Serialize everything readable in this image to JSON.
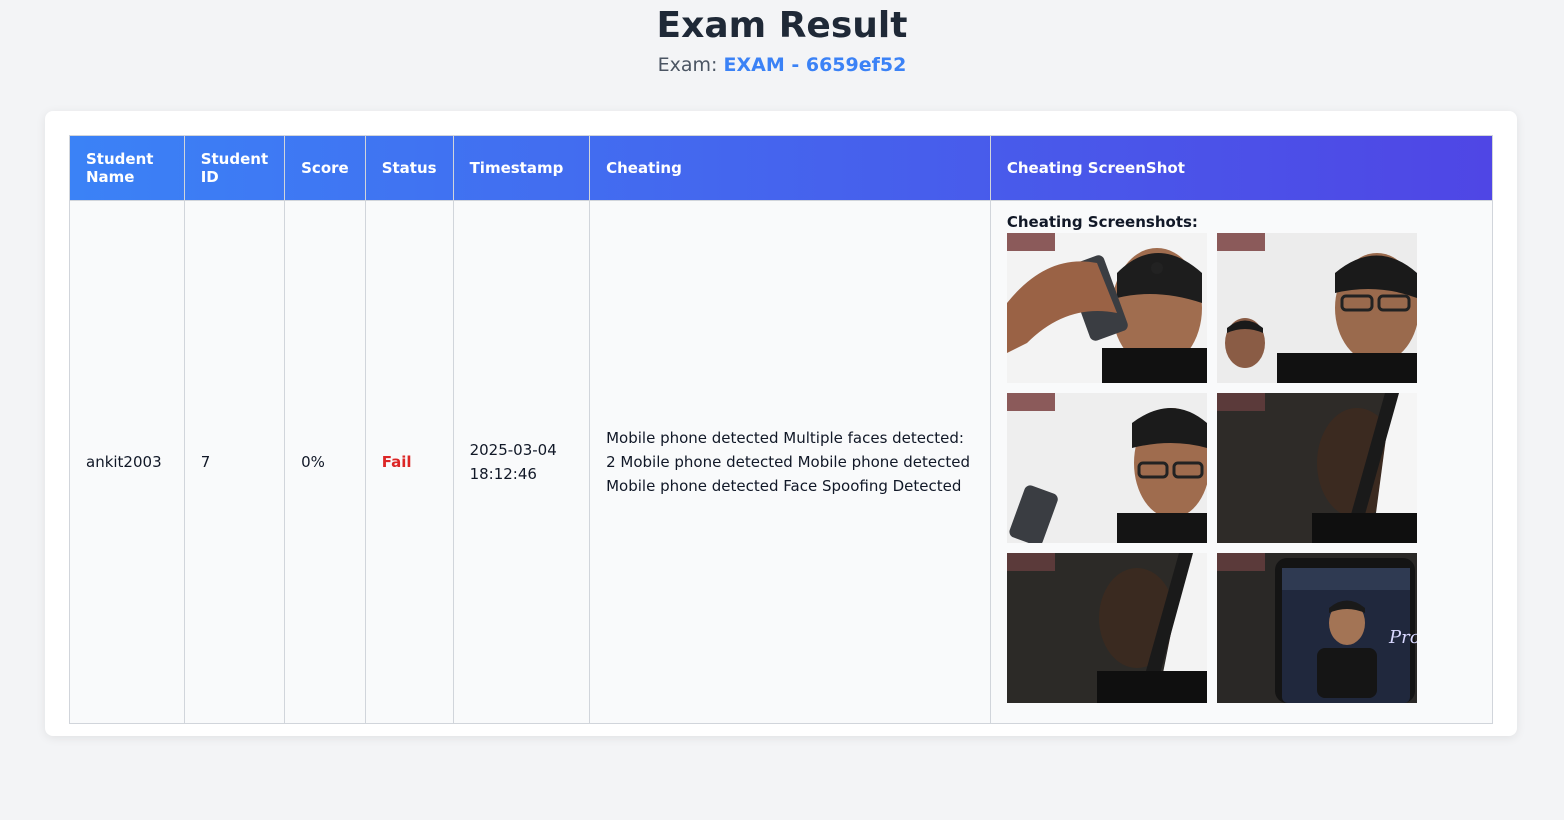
{
  "page": {
    "title": "Exam Result",
    "exam_label": "Exam:",
    "exam_code": "EXAM - 6659ef52"
  },
  "table": {
    "headers": [
      "Student Name",
      "Student ID",
      "Score",
      "Status",
      "Timestamp",
      "Cheating",
      "Cheating ScreenShot"
    ],
    "row": {
      "student_name": "ankit2003",
      "student_id": "7",
      "score": "0%",
      "status": "Fail",
      "timestamp": "2025-03-04 18:12:46",
      "cheating": "Mobile phone detected Multiple faces detected: 2 Mobile phone detected Mobile phone detected Mobile phone detected Face Spoofing Detected",
      "screenshots_label": "Cheating Screenshots:",
      "screenshots": [
        {
          "desc": "person holding phone near face"
        },
        {
          "desc": "person with second face in background"
        },
        {
          "desc": "person holding phone at bottom"
        },
        {
          "desc": "dark frame with bright object"
        },
        {
          "desc": "dark frame with bright object"
        },
        {
          "desc": "phone screen showing another person"
        }
      ]
    }
  },
  "colors": {
    "accent": "#3b82f6",
    "header_gradient_end": "#4f46e5",
    "fail": "#dc2626"
  }
}
